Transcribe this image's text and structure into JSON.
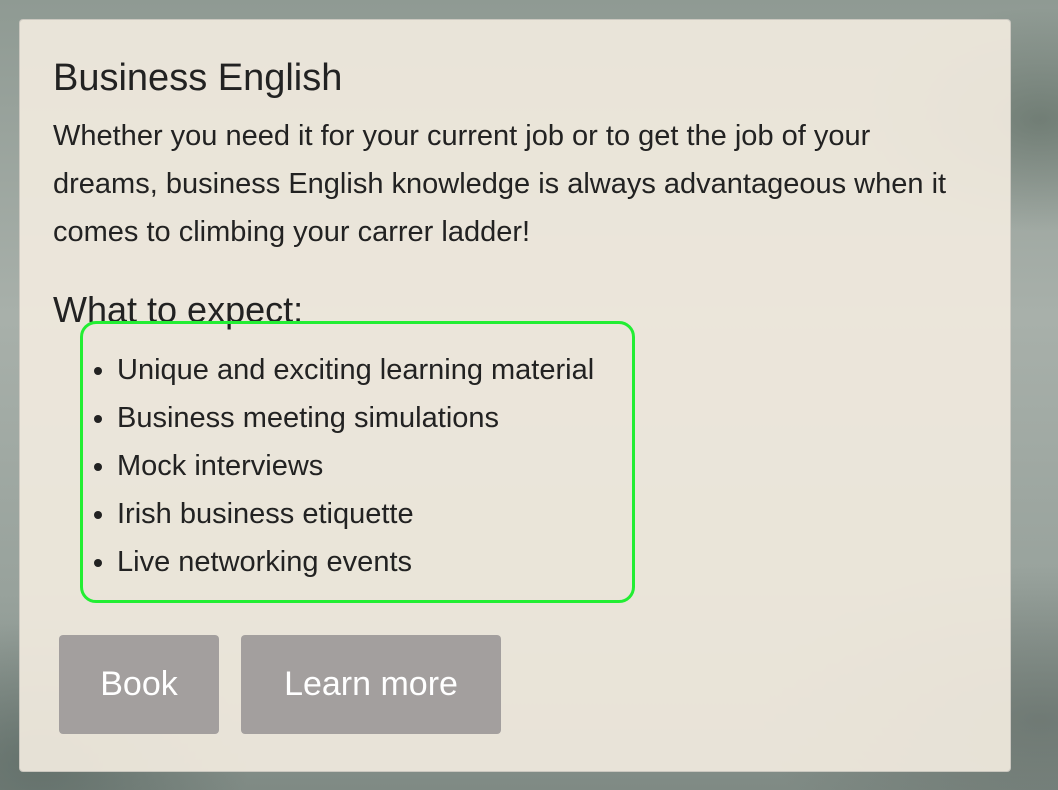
{
  "card": {
    "title": "Business English",
    "description": "Whether you need it for your current job or to get the job of your dreams, business English knowledge is always advantageous when it comes to climbing your carrer ladder!",
    "section_heading": "What to expect:",
    "features": [
      "Unique and exciting learning material",
      "Business meeting simulations",
      "Mock interviews",
      "Irish business etiquette",
      "Live networking events"
    ],
    "buttons": {
      "book": "Book",
      "learn_more": "Learn more"
    }
  },
  "colors": {
    "button_bg": "#a39f9e",
    "highlight": "#22ee33",
    "card_bg": "#f0eade"
  }
}
